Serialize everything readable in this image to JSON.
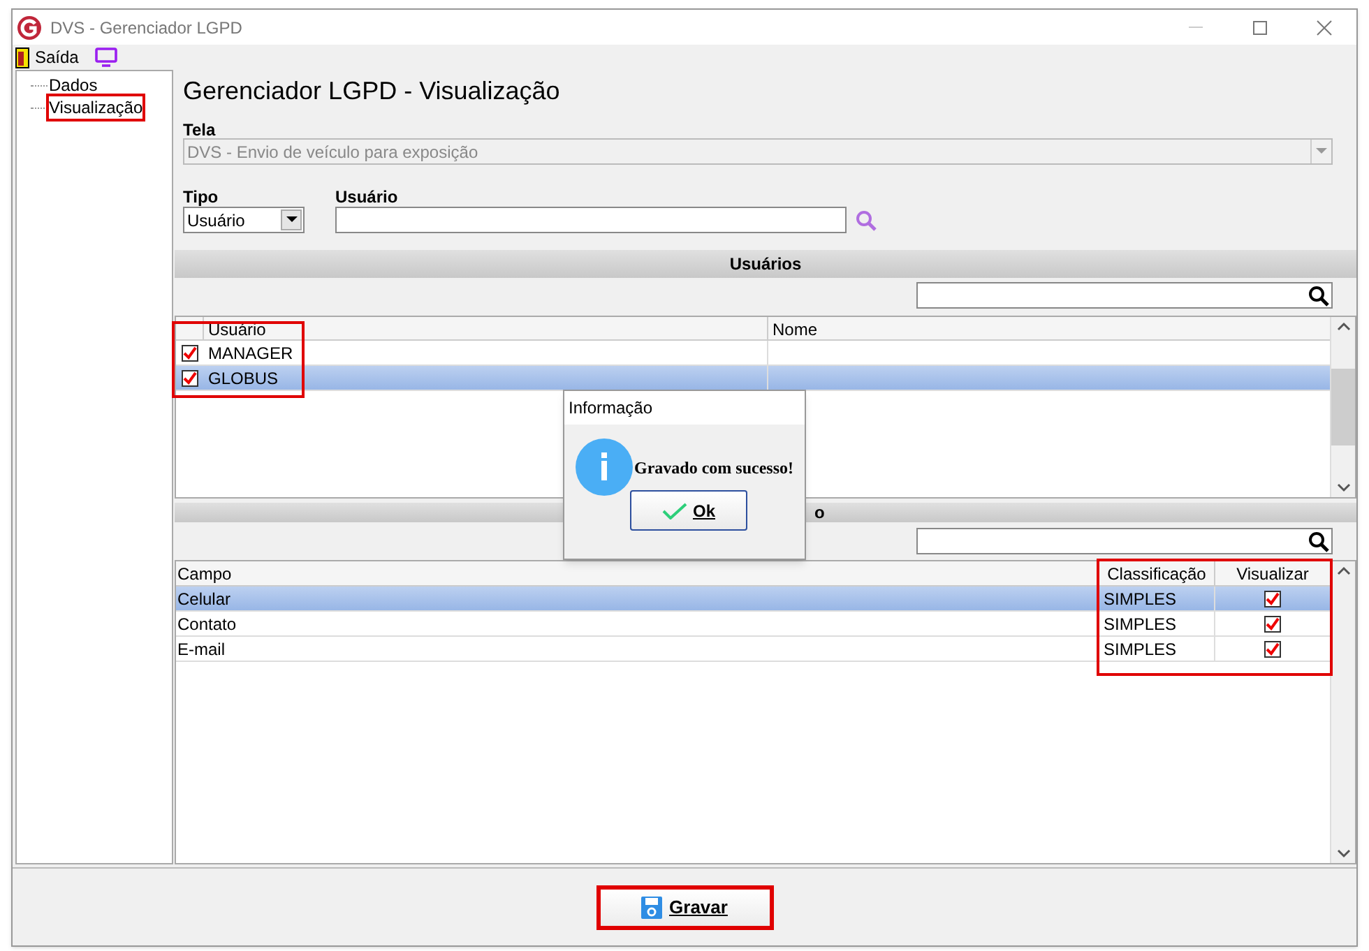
{
  "window": {
    "title": "DVS - Gerenciador LGPD"
  },
  "toolbar": {
    "exit_label": "Saída"
  },
  "tree": {
    "items": [
      {
        "label": "Dados",
        "selected": false
      },
      {
        "label": "Visualização",
        "selected": true
      }
    ]
  },
  "form": {
    "heading": "Gerenciador LGPD - Visualização",
    "tela_label": "Tela",
    "tela_value": "DVS - Envio de veículo para exposição",
    "tipo_label": "Tipo",
    "tipo_value": "Usuário",
    "usuario_label": "Usuário"
  },
  "users_section": {
    "title": "Usuários",
    "columns": [
      "Usuário",
      "Nome"
    ],
    "rows": [
      {
        "checked": true,
        "cells": [
          "MANAGER",
          ""
        ],
        "selected": false
      },
      {
        "checked": true,
        "cells": [
          "GLOBUS",
          ""
        ],
        "selected": true
      }
    ]
  },
  "fields_section": {
    "title_visible": "o",
    "columns": [
      "Campo",
      "Classificação",
      "Visualizar"
    ],
    "rows": [
      {
        "campo": "Celular",
        "classificacao": "SIMPLES",
        "checked": true,
        "selected": true
      },
      {
        "campo": "Contato",
        "classificacao": "SIMPLES",
        "checked": true,
        "selected": false
      },
      {
        "campo": "E-mail",
        "classificacao": "SIMPLES",
        "checked": true,
        "selected": false
      }
    ]
  },
  "dialog": {
    "title": "Informação",
    "message": "Gravado com sucesso!",
    "button": "Ok"
  },
  "footer": {
    "save_button": "Gravar"
  }
}
